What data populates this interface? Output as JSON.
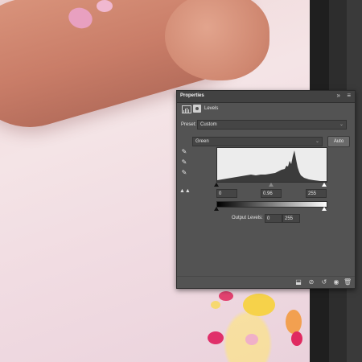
{
  "panel": {
    "tab_title": "Properties",
    "expand_icon": "double-chevron-right-icon",
    "menu_icon": "hamburger-menu-icon",
    "adjustment_label": "Levels",
    "preset": {
      "label": "Preset:",
      "value": "Custom"
    },
    "channel": {
      "value": "Green"
    },
    "auto_button": "Auto",
    "input_levels": {
      "black": "0",
      "gamma": "0.96",
      "white": "255"
    },
    "output_levels": {
      "label": "Output Levels:",
      "black": "0",
      "white": "255"
    }
  },
  "colors": {
    "panel_bg": "#535353",
    "field_bg": "#454545",
    "sidebar_bg": "#2d2d2d"
  }
}
